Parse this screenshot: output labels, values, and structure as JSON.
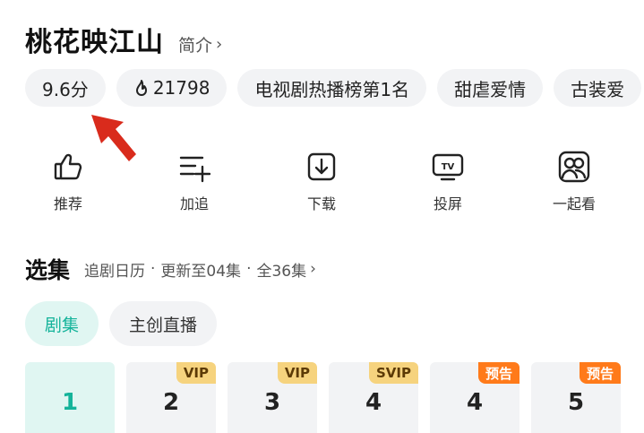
{
  "show": {
    "title": "桃花映江山",
    "intro_label": "简介",
    "intro_chevron": "›"
  },
  "tags": [
    {
      "text": "9.6分"
    },
    {
      "text": "21798",
      "icon": "flame-icon"
    },
    {
      "text": "电视剧热播榜第1名"
    },
    {
      "text": "甜虐爱情"
    },
    {
      "text": "古装爱"
    }
  ],
  "annotation": {
    "icon": "red-arrow",
    "color": "#d92b1c"
  },
  "actions": [
    {
      "label": "推荐",
      "icon": "thumbs-up-icon"
    },
    {
      "label": "加追",
      "icon": "add-to-list-icon"
    },
    {
      "label": "下载",
      "icon": "download-icon"
    },
    {
      "label": "投屏",
      "icon": "tv-cast-icon"
    },
    {
      "label": "一起看",
      "icon": "watch-together-icon"
    }
  ],
  "episodes_section": {
    "title": "选集",
    "calendar": "追剧日历",
    "dot": "·",
    "updated": "更新至04集",
    "total": "全36集",
    "chevron": "›"
  },
  "subtabs": [
    {
      "label": "剧集",
      "active": true
    },
    {
      "label": "主创直播",
      "active": false
    }
  ],
  "episodes": [
    {
      "number": "1",
      "active": true
    },
    {
      "number": "2",
      "badge": "VIP"
    },
    {
      "number": "3",
      "badge": "VIP"
    },
    {
      "number": "4",
      "badge": "SVIP"
    },
    {
      "number": "4",
      "badge": "预告"
    },
    {
      "number": "5",
      "badge": "预告"
    }
  ],
  "colors": {
    "accent": "#14b39a",
    "accent_bg": "#e0f6f2",
    "vip_bg": "#f6d37e",
    "preview_bg": "#ff7a1a",
    "chip_bg": "#f2f3f5"
  }
}
